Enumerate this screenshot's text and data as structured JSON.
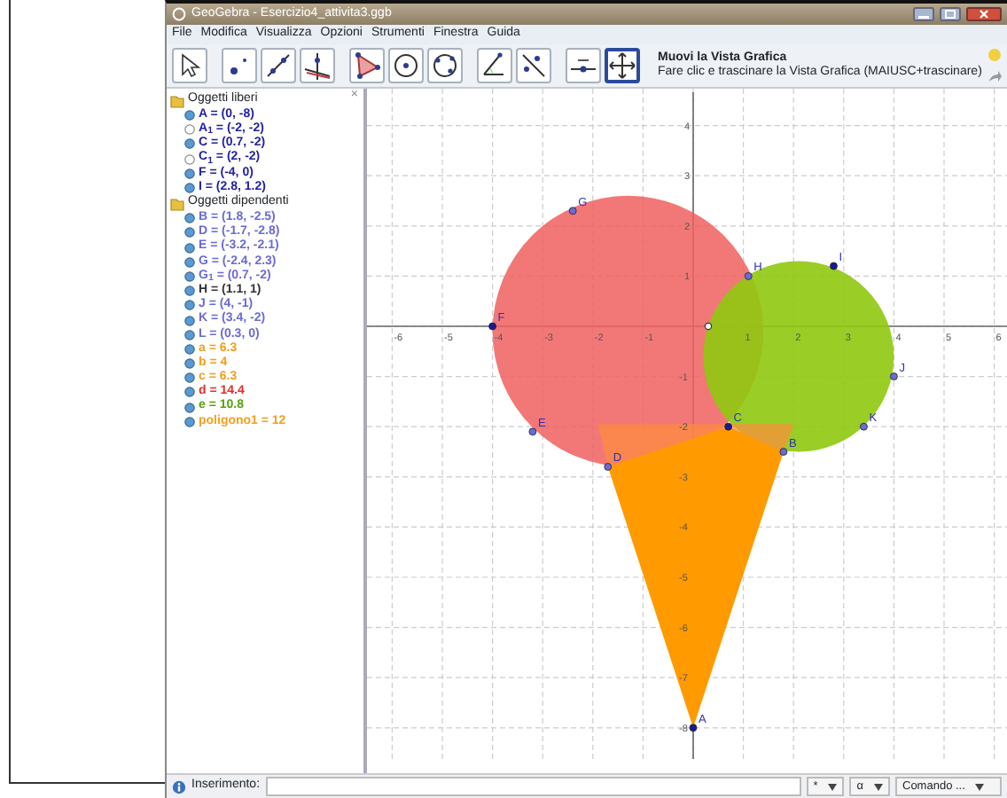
{
  "window": {
    "title": "GeoGebra - Esercizio4_attivita3.ggb"
  },
  "menu": [
    "File",
    "Modifica",
    "Visualizza",
    "Opzioni",
    "Strumenti",
    "Finestra",
    "Guida"
  ],
  "toolbar": {
    "tools": [
      {
        "kind": "pointer",
        "selected": false
      },
      {
        "kind": "point",
        "selected": false
      },
      {
        "kind": "line",
        "selected": false
      },
      {
        "kind": "perpendicular",
        "selected": false
      },
      {
        "kind": "polygon",
        "selected": false
      },
      {
        "kind": "circle",
        "selected": false
      },
      {
        "kind": "conic",
        "selected": false
      },
      {
        "kind": "angle",
        "selected": false
      },
      {
        "kind": "reflect",
        "selected": false
      },
      {
        "kind": "slider",
        "selected": false
      },
      {
        "kind": "move-view",
        "selected": true
      }
    ],
    "tool_name": "Muovi la Vista Grafica",
    "tool_help": "Fare clic e trascinare la Vista Grafica (MAIUSC+trascinare)"
  },
  "algebra": {
    "close_glyph": "×",
    "folders": [
      {
        "label": "Oggetti liberi",
        "items": [
          {
            "text": "A = (0, -8)",
            "color": "#1f1fa0",
            "visible": true
          },
          {
            "text": "A$_{1}$ = (-2, -2)",
            "color": "#1f1fa0",
            "visible": false
          },
          {
            "text": "C = (0.7, -2)",
            "color": "#1f1fa0",
            "visible": true
          },
          {
            "text": "C$_{1}$ = (2, -2)",
            "color": "#1f1fa0",
            "visible": false
          },
          {
            "text": "F = (-4, 0)",
            "color": "#1f1fa0",
            "visible": true
          },
          {
            "text": "I = (2.8, 1.2)",
            "color": "#1f1fa0",
            "visible": true
          }
        ]
      },
      {
        "label": "Oggetti dipendenti",
        "items": [
          {
            "text": "B = (1.8, -2.5)",
            "color": "#6a6ad8",
            "visible": true
          },
          {
            "text": "D = (-1.7, -2.8)",
            "color": "#6a6ad8",
            "visible": true
          },
          {
            "text": "E = (-3.2, -2.1)",
            "color": "#6a6ad8",
            "visible": true
          },
          {
            "text": "G = (-2.4, 2.3)",
            "color": "#6a6ad8",
            "visible": true
          },
          {
            "text": "G$_{1}$ = (0.7, -2)",
            "color": "#6a6ad8",
            "visible": true
          },
          {
            "text": "H = (1.1, 1)",
            "color": "#333333",
            "visible": true
          },
          {
            "text": "J = (4, -1)",
            "color": "#6a6ad8",
            "visible": true
          },
          {
            "text": "K = (3.4, -2)",
            "color": "#6a6ad8",
            "visible": true
          },
          {
            "text": "L = (0.3, 0)",
            "color": "#6a6ad8",
            "visible": true
          },
          {
            "text": "a = 6.3",
            "color": "#f0a020",
            "visible": true
          },
          {
            "text": "b = 4",
            "color": "#f0a020",
            "visible": true
          },
          {
            "text": "c = 6.3",
            "color": "#f0a020",
            "visible": true
          },
          {
            "text": "d = 14.4",
            "color": "#e03030",
            "visible": true
          },
          {
            "text": "e = 10.8",
            "color": "#5aa010",
            "visible": true
          },
          {
            "text": "poligono1 = 12",
            "color": "#f0a020",
            "visible": true
          }
        ]
      }
    ]
  },
  "graph": {
    "x_ticks": [
      "-6",
      "-5",
      "-4",
      "-3",
      "-2",
      "-1",
      "1",
      "2",
      "3",
      "4",
      "5",
      "6"
    ],
    "y_ticks": [
      "4",
      "3",
      "2",
      "1",
      "-1",
      "-2",
      "-3",
      "-4",
      "-5",
      "-6",
      "-7",
      "-8"
    ],
    "point_labels": [
      "A",
      "B",
      "C",
      "D",
      "E",
      "F",
      "G",
      "H",
      "I",
      "J",
      "K"
    ]
  },
  "input_bar": {
    "label": "Inserimento:",
    "symbol_menu": "*",
    "greek_menu": "α",
    "command_menu": "Comando ..."
  }
}
